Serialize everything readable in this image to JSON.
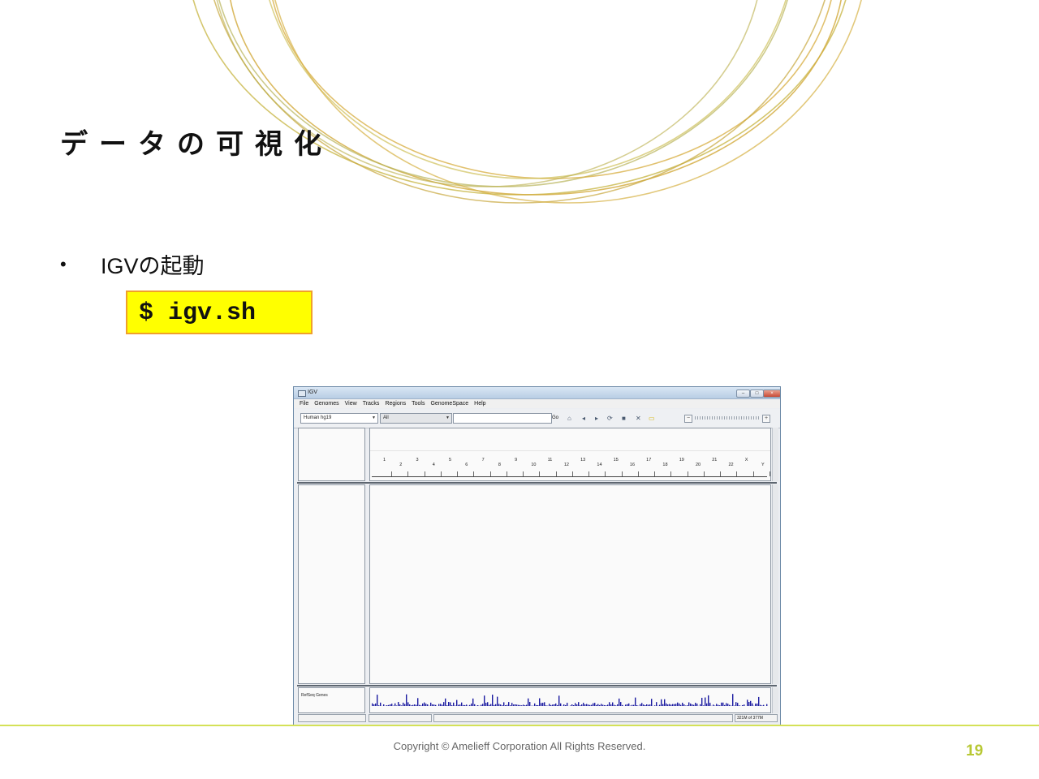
{
  "slide": {
    "title": "データの可視化",
    "bullet_marker": "•",
    "bullet_text": "IGVの起動",
    "command": "$ igv.sh",
    "copyright": "Copyright © Amelieff Corporation All Rights Reserved.",
    "page_number": "19"
  },
  "igv": {
    "window_title": "IGV",
    "menu": [
      "File",
      "Genomes",
      "View",
      "Tracks",
      "Regions",
      "Tools",
      "GenomeSpace",
      "Help"
    ],
    "genome_select": "Human hg19",
    "chromosome_select": "All",
    "locus_value": "",
    "go_label": "Go",
    "chromosomes_top": [
      "1",
      "3",
      "5",
      "7",
      "9",
      "11",
      "13",
      "15",
      "17",
      "19",
      "21",
      "X"
    ],
    "chromosomes_bottom": [
      "2",
      "4",
      "6",
      "8",
      "10",
      "12",
      "14",
      "16",
      "18",
      "20",
      "22",
      "Y"
    ],
    "track_name": "RefSeq Genes",
    "memory_status": "321M of 377M"
  },
  "colors": {
    "command_bg": "#ffff00",
    "command_border": "#f0a02a",
    "footer_line": "#d4e157",
    "page_number": "#b8c834",
    "gene_track": "#1a1aa0"
  },
  "icons": [
    "home-icon",
    "back-icon",
    "forward-icon",
    "refresh-icon",
    "region-icon",
    "resize-icon",
    "popup-info-icon",
    "zoom-out-icon",
    "zoom-in-icon"
  ]
}
